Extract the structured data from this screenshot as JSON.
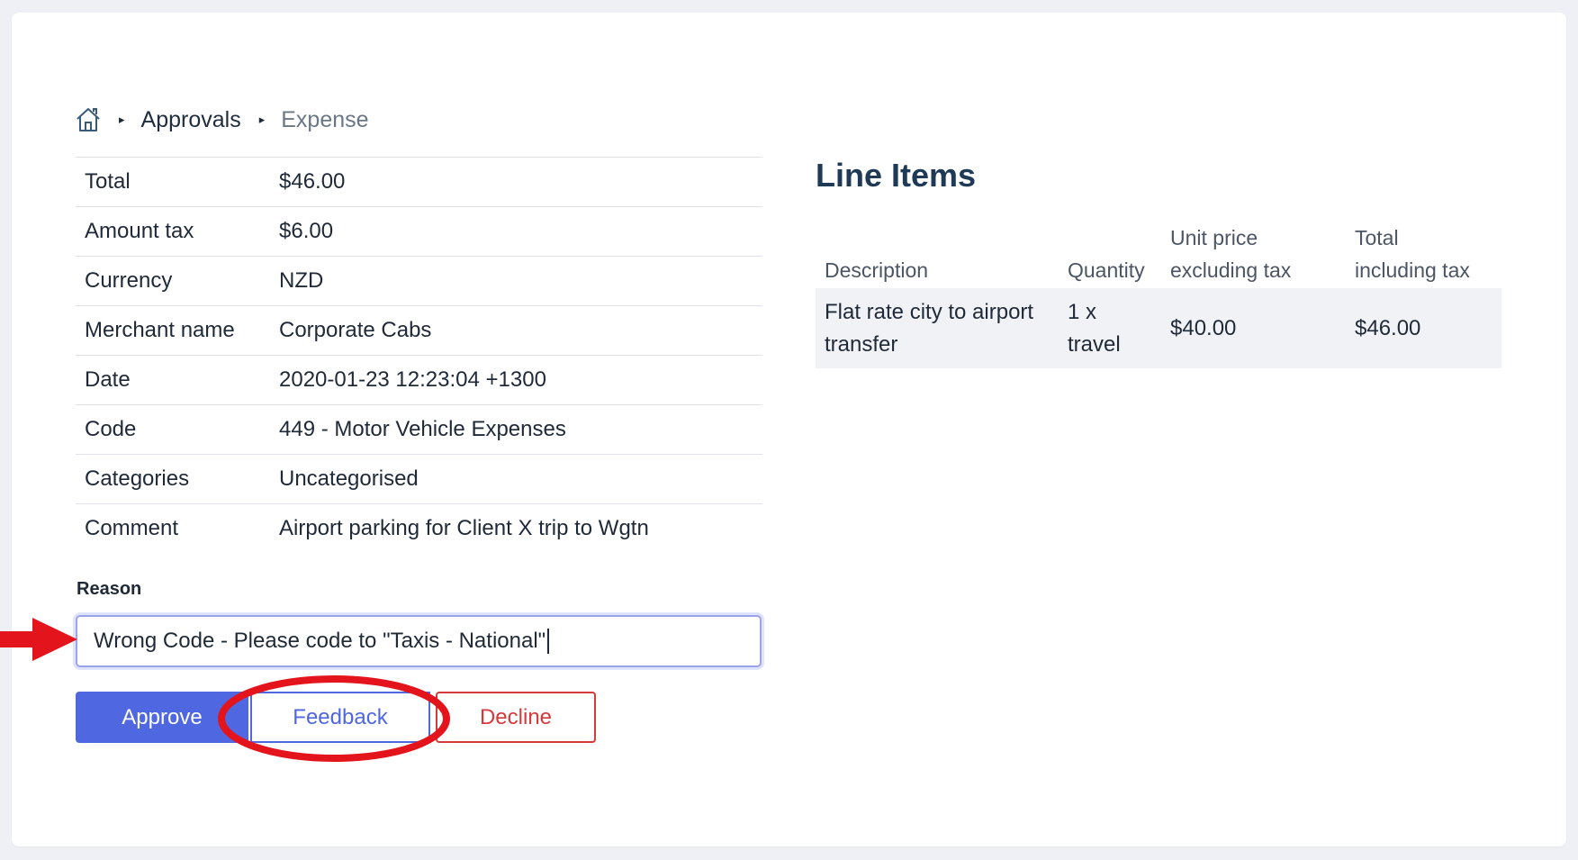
{
  "breadcrumb": {
    "home_icon": "home-icon",
    "items": [
      "Approvals",
      "Expense"
    ],
    "separator": "▸"
  },
  "details": [
    {
      "label": "Total",
      "value": "$46.00"
    },
    {
      "label": "Amount tax",
      "value": "$6.00"
    },
    {
      "label": "Currency",
      "value": "NZD"
    },
    {
      "label": "Merchant name",
      "value": "Corporate Cabs"
    },
    {
      "label": "Date",
      "value": "2020-01-23 12:23:04 +1300"
    },
    {
      "label": "Code",
      "value": "449 - Motor Vehicle Expenses"
    },
    {
      "label": "Categories",
      "value": "Uncategorised"
    },
    {
      "label": "Comment",
      "value": "Airport parking for Client X trip to Wgtn"
    }
  ],
  "reason": {
    "label": "Reason",
    "value": "Wrong Code - Please code to \"Taxis - National\""
  },
  "buttons": {
    "approve": "Approve",
    "feedback": "Feedback",
    "decline": "Decline"
  },
  "line_items": {
    "title": "Line Items",
    "headers": {
      "description": "Description",
      "quantity": "Quantity",
      "unit_price_1": "Unit price",
      "unit_price_2": "excluding tax",
      "total_1": "Total",
      "total_2": "including tax"
    },
    "rows": [
      {
        "description_1": "Flat rate city to airport",
        "description_2": "transfer",
        "quantity_1": "1 x",
        "quantity_2": "travel",
        "unit_price": "$40.00",
        "total": "$46.00"
      }
    ]
  },
  "colors": {
    "primary": "#4f67e0",
    "danger": "#d63a3a",
    "annotation_red": "#e3141b",
    "title": "#1e3a56"
  }
}
